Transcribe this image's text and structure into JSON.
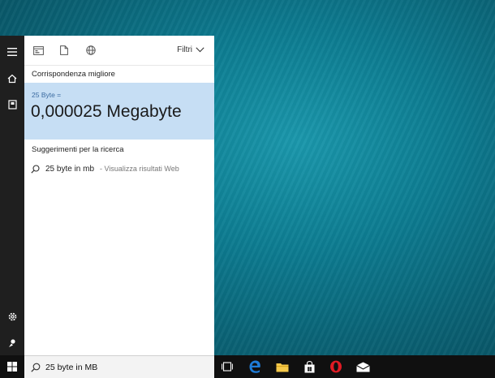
{
  "panel": {
    "tabs": {
      "filter_label": "Filtri"
    },
    "best_match": {
      "section_label": "Corrispondenza migliore",
      "query_label": "25 Byte =",
      "result": "0,000025 Megabyte"
    },
    "suggestions": {
      "section_label": "Suggerimenti per la ricerca",
      "items": [
        {
          "query": "25 byte in mb",
          "action": "- Visualizza risultati Web"
        }
      ]
    }
  },
  "taskbar": {
    "search_value": "25 byte in MB"
  },
  "colors": {
    "best_match_bg": "#c6def4",
    "rail_bg": "#1f1f1f",
    "taskbar_bg": "#101010",
    "edge_blue": "#1e7cd8",
    "opera_red": "#e01b24",
    "explorer_yellow": "#f5c94a"
  },
  "icons": {
    "rail": [
      "hamburger-menu-icon",
      "home-icon",
      "notebook-icon",
      "settings-gear-icon",
      "feedback-icon"
    ],
    "tabs": [
      "apps-tab-icon",
      "documents-tab-icon",
      "web-tab-icon"
    ],
    "taskbar": [
      "windows-start-icon",
      "search-icon",
      "task-view-icon",
      "edge-icon",
      "file-explorer-icon",
      "store-icon",
      "opera-icon",
      "mail-icon"
    ]
  }
}
